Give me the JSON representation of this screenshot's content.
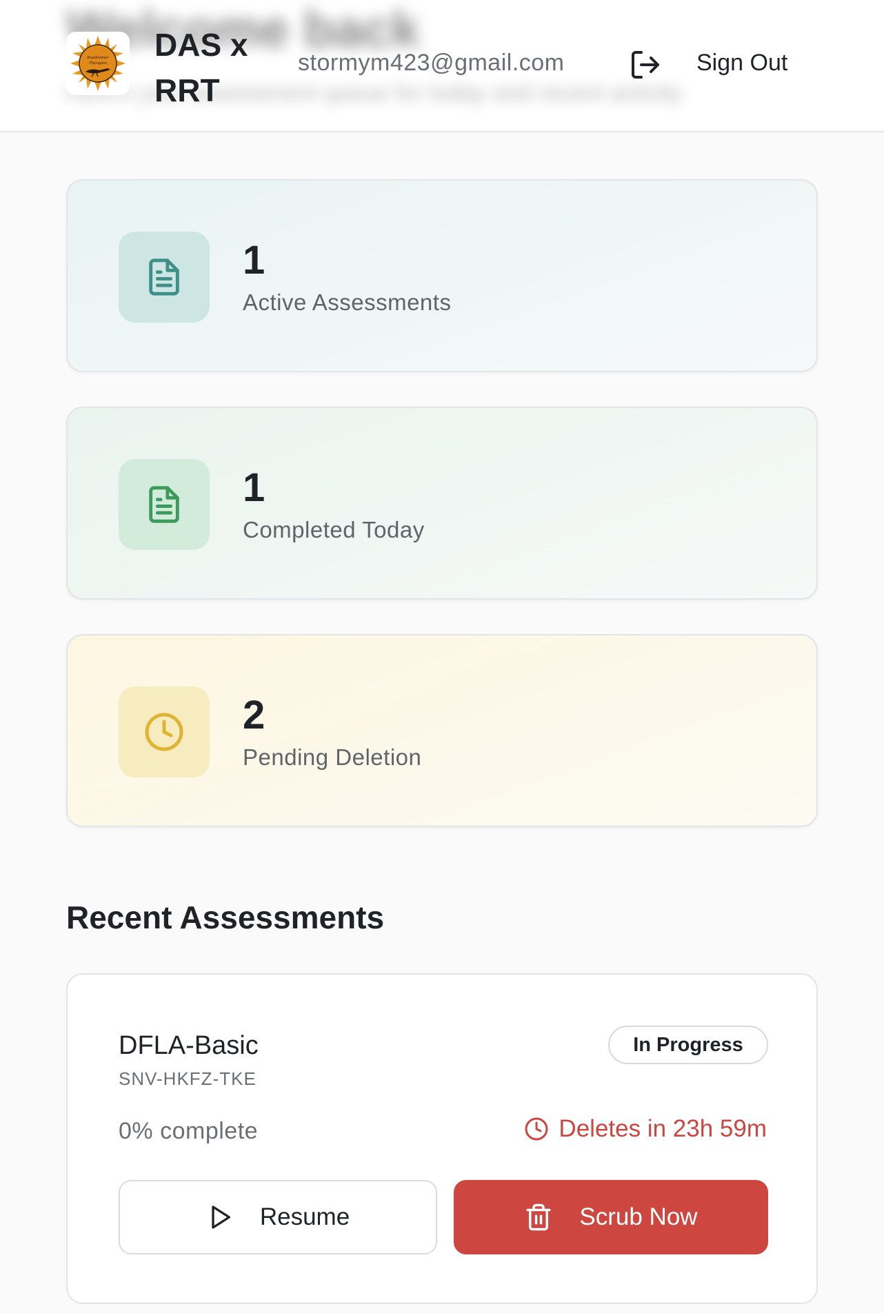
{
  "header": {
    "blurred_title": "Welcome back",
    "blurred_subtitle": "Here's your assessment queue for today and recent activity",
    "app_title": "DAS x RRT",
    "logo": {
      "icon": "roadrunner-therapies-logo",
      "text": "Roadrunner Therapies"
    },
    "user_email": "stormym423@gmail.com",
    "sign_out_label": "Sign Out",
    "sign_out_icon": "sign-out-icon"
  },
  "stats": [
    {
      "value": "1",
      "label": "Active Assessments",
      "icon": "document-icon",
      "color": "#3f8f89"
    },
    {
      "value": "1",
      "label": "Completed Today",
      "icon": "document-icon",
      "color": "#3c9a5d"
    },
    {
      "value": "2",
      "label": "Pending Deletion",
      "icon": "clock-icon",
      "color": "#e0b430"
    }
  ],
  "recent": {
    "title": "Recent Assessments",
    "items": [
      {
        "name": "DFLA-Basic",
        "code": "SNV-HKFZ-TKE",
        "status": "In Progress",
        "progress_text": "0% complete",
        "progress": 0,
        "deletion_text": "Deletes in 23h 59m",
        "resume_label": "Resume",
        "scrub_label": "Scrub Now"
      }
    ]
  },
  "colors": {
    "danger": "#cd4640",
    "text_primary": "#1f2328",
    "text_muted": "#6b6f75"
  }
}
